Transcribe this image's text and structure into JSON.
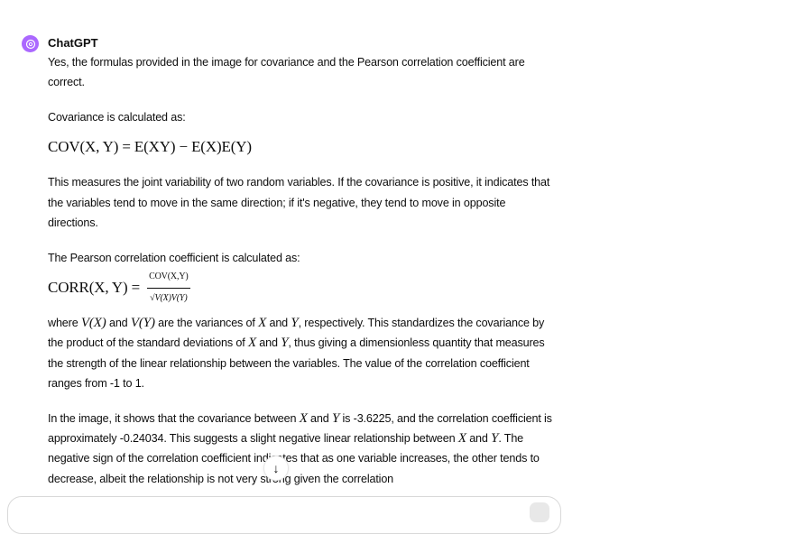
{
  "message": {
    "author": "ChatGPT",
    "p1": "Yes, the formulas provided in the image for covariance and the Pearson correlation coefficient are correct.",
    "p2": "Covariance is calculated as:",
    "formula1": "COV(X, Y) = E(XY) − E(X)E(Y)",
    "p3": "This measures the joint variability of two random variables. If the covariance is positive, it indicates that the variables tend to move in the same direction; if it's negative, they tend to move in opposite directions.",
    "p4": "The Pearson correlation coefficient is calculated as:",
    "formula2_lhs": "CORR(X, Y) =",
    "formula2_num": "COV(X,Y)",
    "formula2_den": "√V(X)V(Y)",
    "p5": {
      "a": "where ",
      "m1": "V(X)",
      "b": " and ",
      "m2": "V(Y)",
      "c": " are the variances of ",
      "m3": "X",
      "d": " and ",
      "m4": "Y",
      "e": ", respectively. This standardizes the covariance by the product of the standard deviations of ",
      "m5": "X",
      "f": " and ",
      "m6": "Y",
      "g": ", thus giving a dimensionless quantity that measures the strength of the linear relationship between the variables. The value of the correlation coefficient ranges from -1 to 1."
    },
    "p6": {
      "a": "In the image, it shows that the covariance between ",
      "m1": "X",
      "b": " and ",
      "m2": "Y",
      "c": " is -3.6225, and the correlation coefficient is approximately -0.24034. This suggests a slight negative linear relationship between ",
      "m3": "X",
      "d": " and ",
      "m4": "Y",
      "e": ". The negative sign of the correlation coefficient indicates that as one variable increases, the other tends to decrease, albeit the relationship is not very strong given the correlation"
    }
  },
  "scroll_button": "↓",
  "colors": {
    "avatar": "#ab68ff"
  }
}
